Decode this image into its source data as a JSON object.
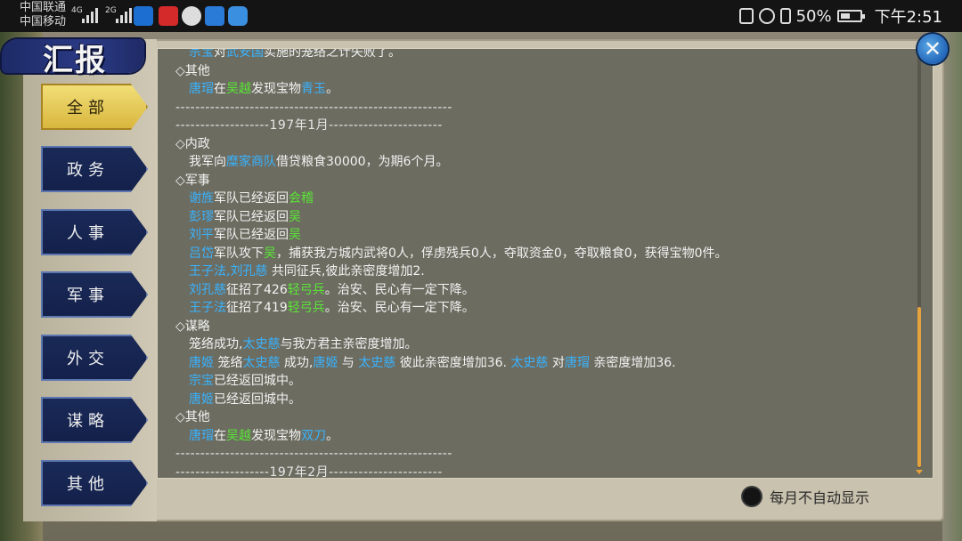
{
  "status_bar": {
    "carrier_1": "中国联通",
    "carrier_2": "中国移动",
    "network_1": "4G",
    "network_2": "2G",
    "battery": "50%",
    "time": "下午2:51"
  },
  "title": "汇报",
  "categories": [
    {
      "label": "全部",
      "active": true
    },
    {
      "label": "政务",
      "active": false
    },
    {
      "label": "人事",
      "active": false
    },
    {
      "label": "军事",
      "active": false
    },
    {
      "label": "外交",
      "active": false
    },
    {
      "label": "谋略",
      "active": false
    },
    {
      "label": "其他",
      "active": false
    }
  ],
  "report": {
    "top_partial": [
      "宗宝",
      "对",
      "武安国",
      "实施的笼络之计失败了。"
    ],
    "block_a": {
      "other_header": "◇其他",
      "treasure_line": [
        "唐瑁",
        "在",
        "吴越",
        "发现宝物",
        "青玉",
        "。"
      ],
      "separator_1": "--------------------------------------------------------",
      "month_line": "-------------------197年1月-----------------------"
    },
    "domestic_header": "◇内政",
    "domestic_line": [
      "我军向",
      "糜家商队",
      "借贷粮食30000，为期6个月。"
    ],
    "military_header": "◇军事",
    "military_lines": [
      [
        "谢旌",
        "军队已经返回",
        "会稽"
      ],
      [
        "彭璆",
        "军队已经返回",
        "吴"
      ],
      [
        "刘平",
        "军队已经返回",
        "吴"
      ]
    ],
    "capture_line": [
      "吕岱",
      "军队攻下",
      "吴",
      "，捕获我方城内武将0人，俘虏残兵0人，夺取资金0，夺取粮食0，获得宝物0件。"
    ],
    "joint_line": [
      "王子法",
      ",",
      "刘孔慈",
      " 共同征兵,彼此亲密度增加2."
    ],
    "recruit_lines": [
      [
        "刘孔慈",
        "征招了426",
        "轻弓兵",
        "。治安、民心有一定下降。"
      ],
      [
        "王子法",
        "征招了419",
        "轻弓兵",
        "。治安、民心有一定下降。"
      ]
    ],
    "strategy_header": "◇谋略",
    "strategy_line_1": [
      "笼络成功,",
      "太史慈",
      "与我方君主亲密度增加。"
    ],
    "strategy_line_2": [
      "唐姬",
      " 笼络",
      "太史慈",
      " 成功,",
      "唐姬",
      " 与 ",
      "太史慈",
      " 彼此亲密度增加36. ",
      "太史慈",
      " 对",
      "唐瑁",
      " 亲密度增加36."
    ],
    "return_lines": [
      [
        "宗宝",
        "已经返回城中。"
      ],
      [
        "唐姬",
        "已经返回城中。"
      ]
    ],
    "other_header_2": "◇其他",
    "treasure_line_2": [
      "唐瑁",
      "在",
      "吴越",
      "发现宝物",
      "双刀",
      "。"
    ],
    "separator_2": "--------------------------------------------------------",
    "month_line_2": "-------------------197年2月-----------------------"
  },
  "auto_display_label": "每月不自动显示",
  "close_label": "✕",
  "colors": {
    "name_blue": "#39b3ff",
    "place_green": "#5ae635",
    "active_tab": "#e8c94e",
    "tab_bg": "#13204a"
  },
  "icons": [
    "close-icon",
    "radio-icon",
    "nfc-icon",
    "alarm-icon",
    "vibrate-icon",
    "battery-icon"
  ]
}
